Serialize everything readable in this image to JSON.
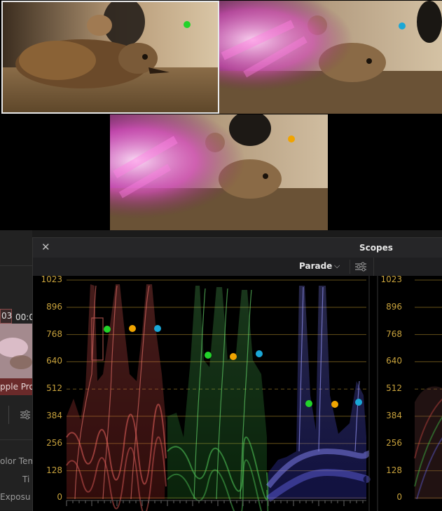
{
  "viewer": {
    "markers": {
      "green": "#22d32a",
      "cyan": "#1aa7d6",
      "orange": "#f0a400"
    }
  },
  "background_app": {
    "timecode_a": "03",
    "timecode_b": "00:0",
    "clip_label": "pple Pro",
    "param_1": "olor Tem",
    "param_2": "Ti",
    "param_3": "Exposu"
  },
  "scopes": {
    "title": "Scopes",
    "mode": "Parade",
    "close_icon": "close-icon",
    "settings_icon": "sliders-icon",
    "axis_labels": [
      "1023",
      "896",
      "768",
      "640",
      "512",
      "384",
      "256",
      "128",
      "0"
    ],
    "channel_colors": {
      "red": "#e0504a",
      "green": "#3fd44a",
      "blue": "#5a5af0"
    },
    "grid_color": "#b8932e"
  }
}
